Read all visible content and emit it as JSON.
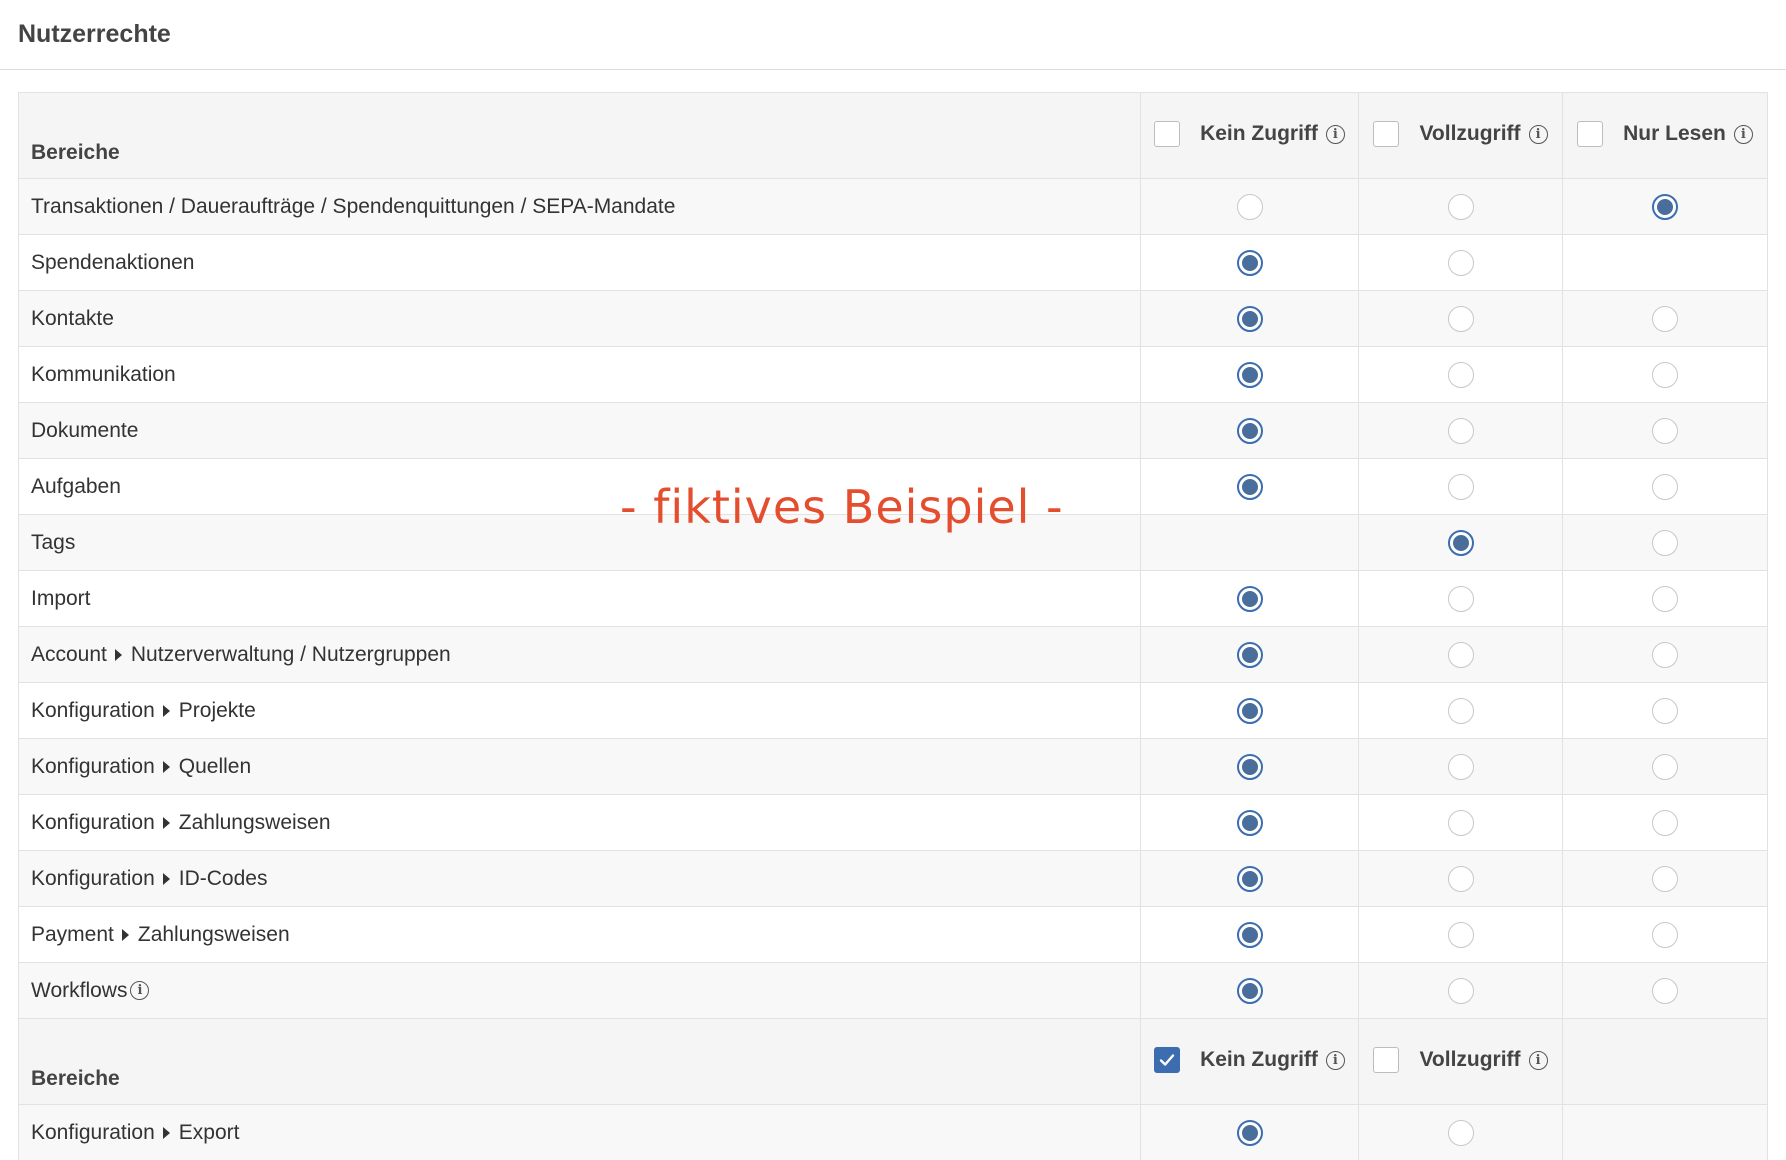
{
  "page": {
    "title": "Nutzerrechte"
  },
  "watermark": "- fiktives Beispiel -",
  "colors": {
    "accent": "#3b6db0",
    "radio_fill": "#4a6e9c",
    "watermark": "#e44d2e",
    "header_bg": "#f5f5f5",
    "border": "#e2e2e2"
  },
  "section1": {
    "header": {
      "area_label": "Bereiche",
      "kein_label": "Kein Zugriff",
      "voll_label": "Vollzugriff",
      "nur_label": "Nur Lesen",
      "kein_checked": false,
      "voll_checked": false,
      "nur_checked": false
    },
    "rows": [
      {
        "parts": [
          "Transaktionen / Daueraufträge / Spendenquittungen / SEPA-Mandate"
        ],
        "info": false,
        "selected": "nur",
        "options": [
          "kein",
          "voll",
          "nur"
        ]
      },
      {
        "parts": [
          "Spendenaktionen"
        ],
        "info": false,
        "selected": "kein",
        "options": [
          "kein",
          "voll"
        ]
      },
      {
        "parts": [
          "Kontakte"
        ],
        "info": false,
        "selected": "kein",
        "options": [
          "kein",
          "voll",
          "nur"
        ]
      },
      {
        "parts": [
          "Kommunikation"
        ],
        "info": false,
        "selected": "kein",
        "options": [
          "kein",
          "voll",
          "nur"
        ]
      },
      {
        "parts": [
          "Dokumente"
        ],
        "info": false,
        "selected": "kein",
        "options": [
          "kein",
          "voll",
          "nur"
        ]
      },
      {
        "parts": [
          "Aufgaben"
        ],
        "info": false,
        "selected": "kein",
        "options": [
          "kein",
          "voll",
          "nur"
        ]
      },
      {
        "parts": [
          "Tags"
        ],
        "info": false,
        "selected": "voll",
        "options": [
          "voll",
          "nur"
        ]
      },
      {
        "parts": [
          "Import"
        ],
        "info": false,
        "selected": "kein",
        "options": [
          "kein",
          "voll",
          "nur"
        ]
      },
      {
        "parts": [
          "Account",
          "Nutzerverwaltung / Nutzergruppen"
        ],
        "info": false,
        "selected": "kein",
        "options": [
          "kein",
          "voll",
          "nur"
        ]
      },
      {
        "parts": [
          "Konfiguration",
          "Projekte"
        ],
        "info": false,
        "selected": "kein",
        "options": [
          "kein",
          "voll",
          "nur"
        ]
      },
      {
        "parts": [
          "Konfiguration",
          "Quellen"
        ],
        "info": false,
        "selected": "kein",
        "options": [
          "kein",
          "voll",
          "nur"
        ]
      },
      {
        "parts": [
          "Konfiguration",
          "Zahlungsweisen"
        ],
        "info": false,
        "selected": "kein",
        "options": [
          "kein",
          "voll",
          "nur"
        ]
      },
      {
        "parts": [
          "Konfiguration",
          "ID-Codes"
        ],
        "info": false,
        "selected": "kein",
        "options": [
          "kein",
          "voll",
          "nur"
        ]
      },
      {
        "parts": [
          "Payment",
          "Zahlungsweisen"
        ],
        "info": false,
        "selected": "kein",
        "options": [
          "kein",
          "voll",
          "nur"
        ]
      },
      {
        "parts": [
          "Workflows"
        ],
        "info": true,
        "selected": "kein",
        "options": [
          "kein",
          "voll",
          "nur"
        ]
      }
    ]
  },
  "section2": {
    "header": {
      "area_label": "Bereiche",
      "kein_label": "Kein Zugriff",
      "voll_label": "Vollzugriff",
      "kein_checked": true,
      "voll_checked": false
    },
    "rows": [
      {
        "parts": [
          "Konfiguration",
          "Export"
        ],
        "info": false,
        "selected": "kein",
        "options": [
          "kein",
          "voll"
        ]
      }
    ]
  }
}
